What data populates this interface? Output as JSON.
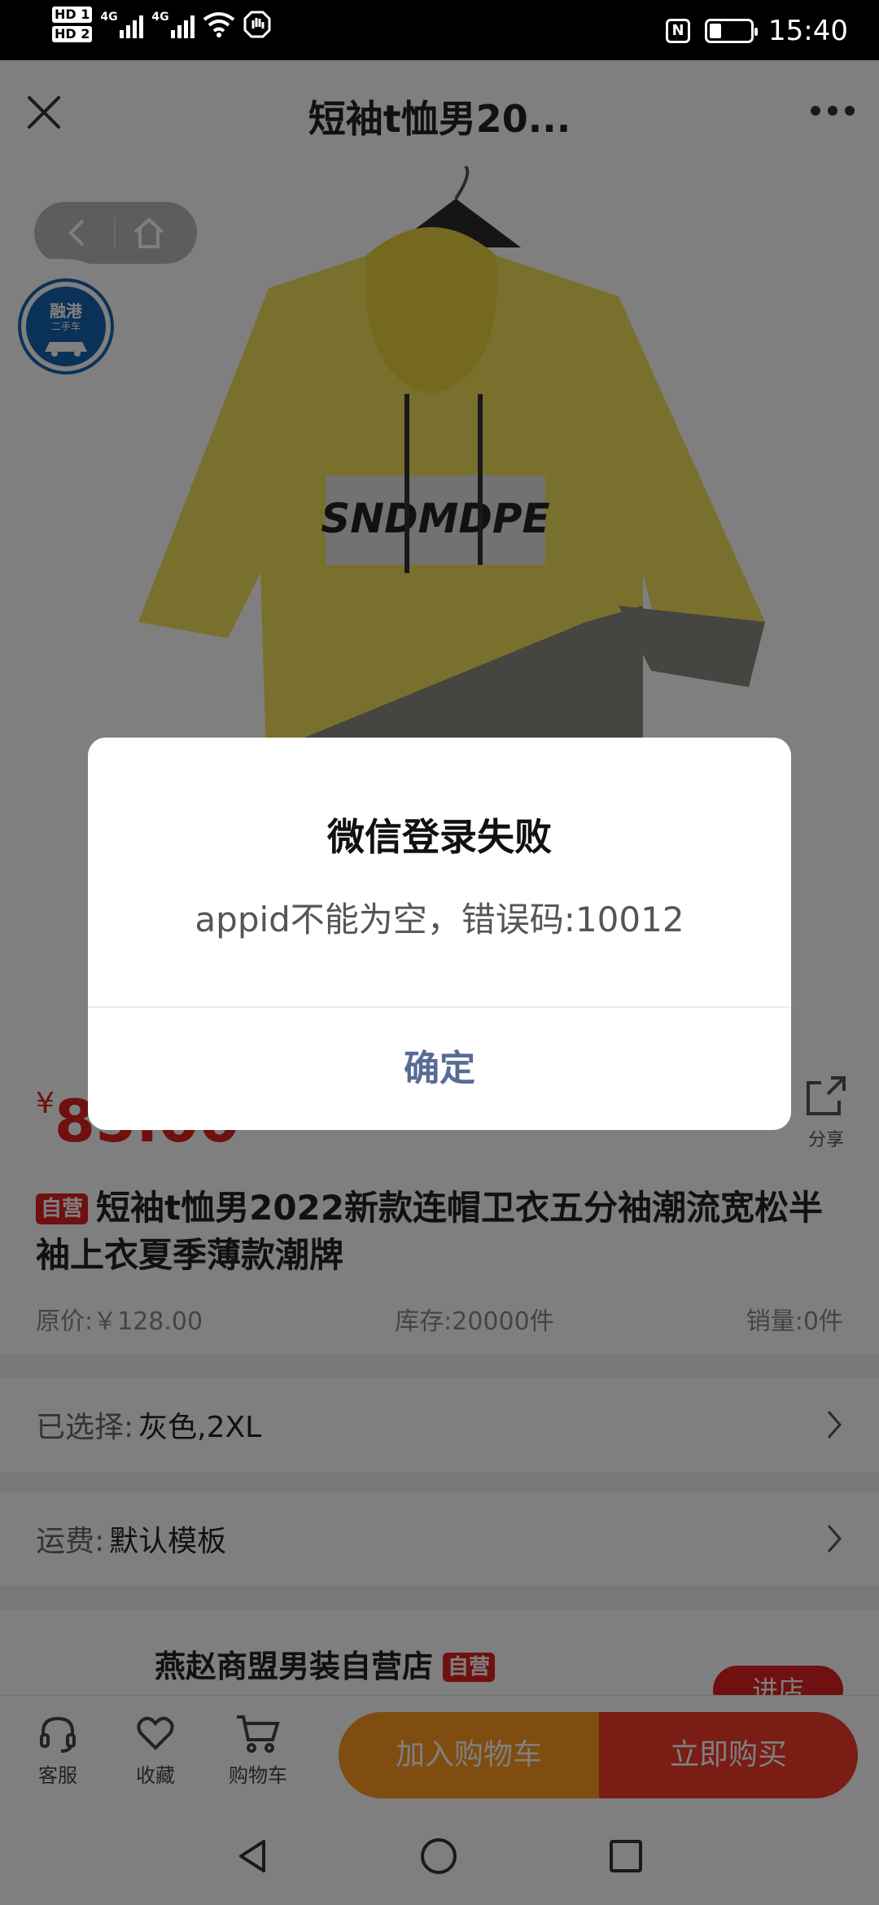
{
  "status_bar": {
    "hd1": "HD 1",
    "hd2": "HD 2",
    "net1": "4G",
    "net2": "4G",
    "nfc": "N",
    "time": "15:40"
  },
  "header": {
    "title": "短袖t恤男20...",
    "close_icon": "close-icon",
    "more_icon": "more-icon"
  },
  "floating_logo": {
    "title": "融港",
    "sub": "二手车"
  },
  "product": {
    "price_currency": "¥",
    "price_value": "85.00",
    "share_label": "分享",
    "self_tag": "自营",
    "title": "短袖t恤男2022新款连帽卫衣五分袖潮流宽松半袖上衣夏季薄款潮牌",
    "original_price": "原价:￥128.00",
    "stock": "库存:20000件",
    "sales": "销量:0件"
  },
  "selection": {
    "label": "已选择:",
    "value": "灰色,2XL"
  },
  "shipping": {
    "label": "运费:",
    "value": "默认模板"
  },
  "store": {
    "name": "燕赵商盟男装自营店",
    "tag": "自营",
    "enter_label": "进店"
  },
  "bottom_bar": {
    "service": "客服",
    "favorite": "收藏",
    "cart": "购物车",
    "add_to_cart": "加入购物车",
    "buy_now": "立即购买"
  },
  "dialog": {
    "title": "微信登录失败",
    "message": "appid不能为空，错误码:10012",
    "confirm": "确定"
  },
  "colors": {
    "accent_red": "#e02020",
    "orange": "#ff9a1e",
    "wechat_link": "#576b95"
  }
}
